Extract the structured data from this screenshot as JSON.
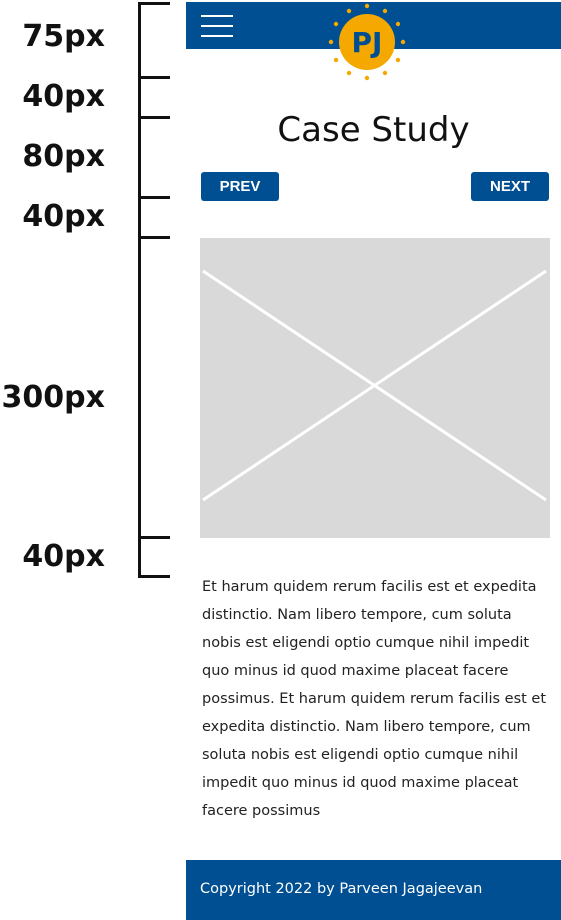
{
  "annotations": {
    "measurements": [
      "75px",
      "40px",
      "80px",
      "40px",
      "300px",
      "40px"
    ]
  },
  "header": {
    "menu_icon": "hamburger-icon",
    "logo_text": "PJ"
  },
  "page": {
    "title": "Case Study",
    "prev_label": "PREV",
    "next_label": "NEXT",
    "image_placeholder": "image-placeholder-icon",
    "body": "Et harum quidem rerum facilis est et expedita distinctio. Nam libero tempore, cum soluta nobis est eligendi optio cumque nihil impedit quo minus id quod maxime placeat facere possimus. Et harum quidem rerum facilis est et expedita distinctio. Nam libero tempore, cum soluta nobis est eligendi optio cumque nihil impedit quo minus id quod maxime placeat facere possimus"
  },
  "footer": {
    "copyright": "Copyright 2022 by Parveen Jagajeevan"
  },
  "colors": {
    "brand": "#004f93",
    "logo": "#f5a800",
    "placeholder": "#d9d9d9"
  }
}
